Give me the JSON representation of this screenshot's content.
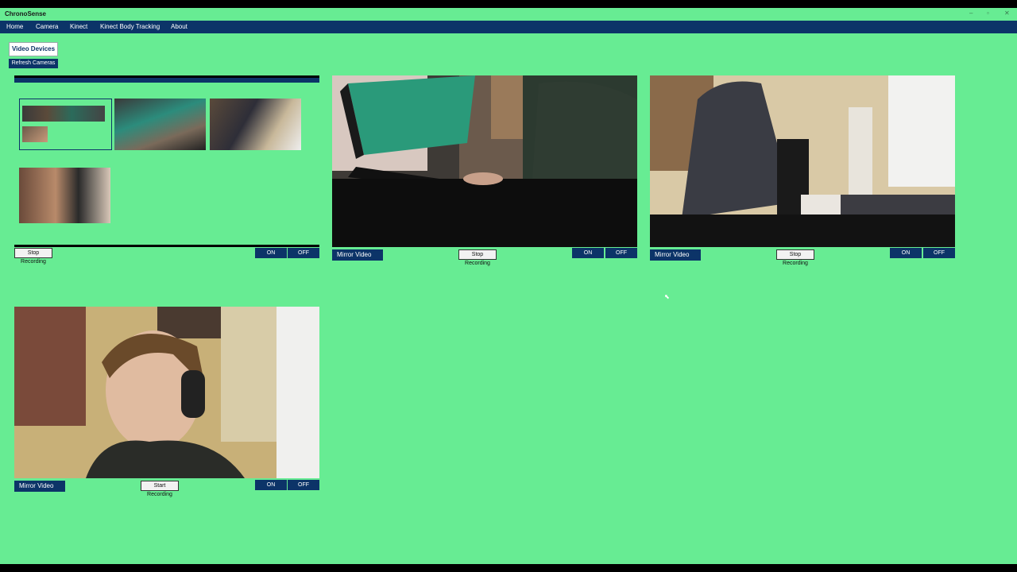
{
  "app": {
    "title": "ChronoSense",
    "window_controls": {
      "minimize": "–",
      "restore": "▫",
      "close": "✕"
    }
  },
  "menu": {
    "items": [
      "Home",
      "Camera",
      "Kinect",
      "Kinect Body Tracking",
      "About"
    ]
  },
  "toolbar": {
    "video_devices_label": "Video Devices",
    "refresh_label": "Refresh Cameras"
  },
  "devices": [
    {
      "name": "screen-capture",
      "recording_label": "Stop Recording",
      "on_label": "ON",
      "off_label": "OFF"
    },
    {
      "name": "camera-desk",
      "mirror_label": "Mirror Video",
      "recording_label": "Stop Recording",
      "on_label": "ON",
      "off_label": "OFF"
    },
    {
      "name": "camera-room",
      "mirror_label": "Mirror Video",
      "recording_label": "Stop Recording",
      "on_label": "ON",
      "off_label": "OFF"
    },
    {
      "name": "camera-face",
      "mirror_label": "Mirror Video",
      "recording_label": "Start Recording",
      "on_label": "ON",
      "off_label": "OFF"
    }
  ],
  "colors": {
    "background": "#67ec93",
    "menubar": "#0c3468",
    "button": "#0c3468",
    "button_text": "#ffffff"
  },
  "icons": {
    "cursor": "mouse-pointer-icon"
  }
}
